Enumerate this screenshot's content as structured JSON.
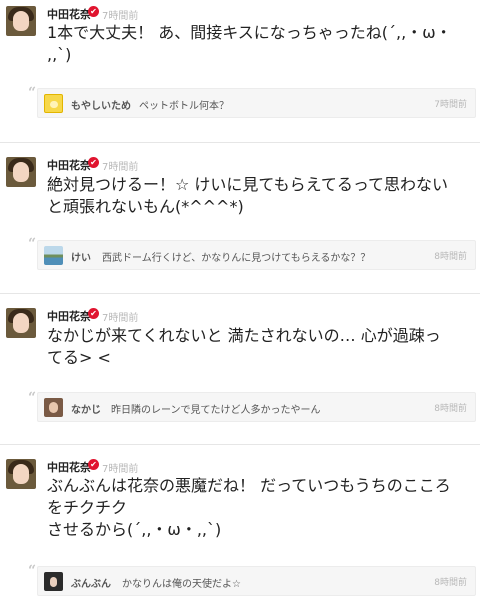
{
  "posts": [
    {
      "author": "中田花奈",
      "time": "7時間前",
      "text_lines": [
        "1本で大丈夫！ あ、間接キスになっちゃったね(´,,・ω・",
        ",,`)"
      ],
      "reply": {
        "name": "もやしいため",
        "text": "ペットボトル何本？",
        "time": "7時間前"
      }
    },
    {
      "author": "中田花奈",
      "time": "7時間前",
      "text_lines": [
        "絶対見つけるー！☆ けいに見てもらえてるって思わない",
        "と頑張れないもん(*^^^*)"
      ],
      "reply": {
        "name": "けい",
        "text": "西武ドーム行くけど、かなりんに見つけてもらえるかな？？",
        "time": "8時間前"
      }
    },
    {
      "author": "中田花奈",
      "time": "7時間前",
      "text_lines": [
        "なかじが来てくれないと 満たされないの… 心が過疎っ",
        "てる> <"
      ],
      "reply": {
        "name": "なかじ",
        "text": "昨日隣のレーンで見てたけど人多かったやーん",
        "time": "8時間前"
      }
    },
    {
      "author": "中田花奈",
      "time": "7時間前",
      "text_lines": [
        "ぶんぶんは花奈の悪魔だね！ だっていつもうちのこころ",
        "をチクチク",
        "させるから(´,,・ω・,,`)"
      ],
      "reply": {
        "name": "ぶんぶん",
        "text": "かなりんは俺の天使だよ☆",
        "time": "8時間前"
      }
    }
  ],
  "icons": {
    "verified": "verified-check-icon",
    "quote": "quote-icon",
    "verified_glyph": "✔",
    "quote_glyph": "“"
  },
  "colors": {
    "verified": "#e0142f",
    "timestamp": "#b8b8b8",
    "reply_background": "#f6f6f6"
  }
}
